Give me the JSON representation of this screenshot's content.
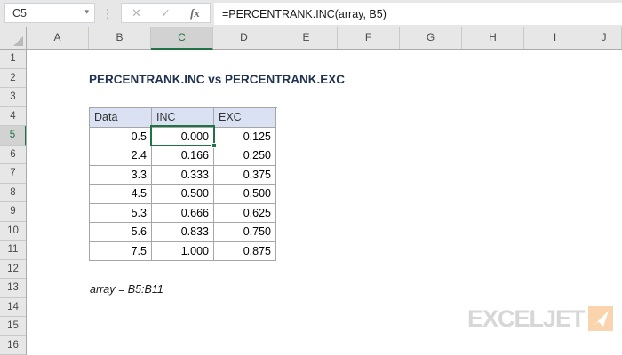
{
  "formula_bar": {
    "name_box": "C5",
    "name_caret": "▾",
    "dots": "⋮",
    "cancel_label": "✕",
    "enter_label": "✓",
    "fx_label": "fx",
    "formula": "=PERCENTRANK.INC(array, B5)"
  },
  "grid": {
    "column_letters": [
      "A",
      "B",
      "C",
      "D",
      "E",
      "F",
      "G",
      "H",
      "I",
      "J"
    ],
    "row_numbers": [
      1,
      2,
      3,
      4,
      5,
      6,
      7,
      8,
      9,
      10,
      11,
      12,
      13,
      14,
      15,
      16
    ],
    "selected_column": "C",
    "selected_row": 5,
    "selected_cell": "C5"
  },
  "sheet": {
    "title": "PERCENTRANK.INC vs PERCENTRANK.EXC",
    "note": "array = B5:B11"
  },
  "table": {
    "column_letters": [
      "B",
      "C",
      "D"
    ],
    "header_row_number": 4,
    "first_data_row_number": 5,
    "headers": [
      "Data",
      "INC",
      "EXC"
    ],
    "rows": [
      [
        "0.5",
        "0.000",
        "0.125"
      ],
      [
        "2.4",
        "0.166",
        "0.250"
      ],
      [
        "3.3",
        "0.333",
        "0.375"
      ],
      [
        "4.5",
        "0.500",
        "0.500"
      ],
      [
        "5.3",
        "0.666",
        "0.625"
      ],
      [
        "5.6",
        "0.833",
        "0.750"
      ],
      [
        "7.5",
        "1.000",
        "0.875"
      ]
    ]
  },
  "logo": {
    "text": "EXCELJET",
    "mark_icon": "paper-plane-arrow"
  },
  "colors": {
    "selection_green": "#217346",
    "header_fill": "#d9e1f2",
    "logo_orange": "#f9d4ad",
    "title_navy": "#1f3252",
    "table_border": "#a6a6a6"
  }
}
